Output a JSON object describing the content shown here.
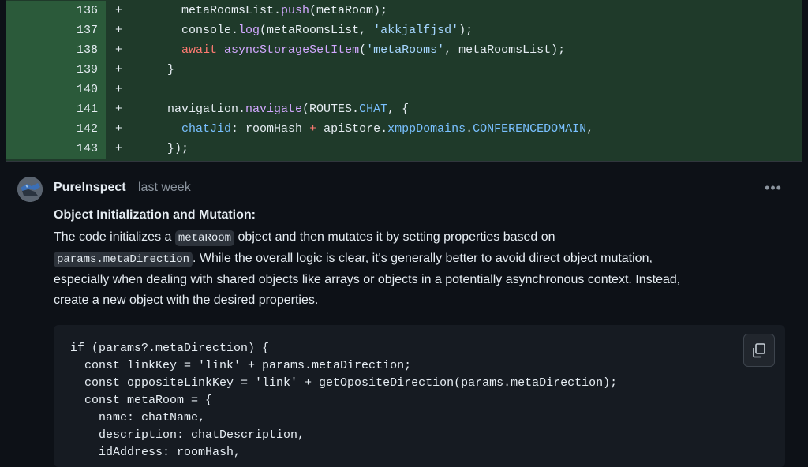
{
  "diff": {
    "rows": [
      {
        "num": "136",
        "sign": "+",
        "code": "      metaRoomsList.push(metaRoom);"
      },
      {
        "num": "137",
        "sign": "+",
        "code": "      console.log(metaRoomsList, 'akkjalfjsd');"
      },
      {
        "num": "138",
        "sign": "+",
        "code": "      await asyncStorageSetItem('metaRooms', metaRoomsList);"
      },
      {
        "num": "139",
        "sign": "+",
        "code": "    }"
      },
      {
        "num": "140",
        "sign": "+",
        "code": ""
      },
      {
        "num": "141",
        "sign": "+",
        "code": "    navigation.navigate(ROUTES.CHAT, {"
      },
      {
        "num": "142",
        "sign": "+",
        "code": "      chatJid: roomHash + apiStore.xmppDomains.CONFERENCEDOMAIN,"
      },
      {
        "num": "143",
        "sign": "+",
        "code": "    });"
      }
    ]
  },
  "comment": {
    "author": "PureInspect",
    "time": "last week",
    "more_label": "•••",
    "heading": "Object Initialization and Mutation:",
    "p1_a": "The code initializes a ",
    "p1_code": "metaRoom",
    "p1_b": " object and then mutates it by setting properties based on",
    "p2_code": "params.metaDirection",
    "p2_b": ". While the overall logic is clear, it's generally better to avoid direct object mutation,",
    "p3": "especially when dealing with shared objects like arrays or objects in a potentially asynchronous context. Instead,",
    "p4": "create a new object with the desired properties.",
    "code_lines": [
      "if (params?.metaDirection) {",
      "  const linkKey = 'link' + params.metaDirection;",
      "  const oppositeLinkKey = 'link' + getOpositeDirection(params.metaDirection);",
      "  const metaRoom = {",
      "    name: chatName,",
      "    description: chatDescription,",
      "    idAddress: roomHash,"
    ]
  },
  "icons": {
    "copy": "copy-icon",
    "avatar": "avatar-image"
  }
}
